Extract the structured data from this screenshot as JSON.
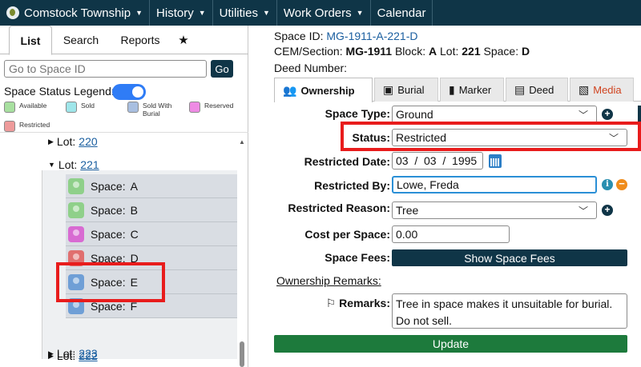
{
  "nav": {
    "items": [
      {
        "label": "Comstock Township",
        "has_caret": true
      },
      {
        "label": "History",
        "has_caret": true
      },
      {
        "label": "Utilities",
        "has_caret": true
      },
      {
        "label": "Work Orders",
        "has_caret": true
      },
      {
        "label": "Calendar",
        "has_caret": false
      }
    ]
  },
  "left": {
    "tabs": [
      "List",
      "Search",
      "Reports",
      "★"
    ],
    "search_placeholder": "Go to Space ID",
    "go_label": "Go",
    "legend_title": "Space Status Legend:",
    "legend": [
      {
        "label": "Available",
        "color": "#a8e0a0"
      },
      {
        "label": "Sold",
        "color": "#9fe6ea"
      },
      {
        "label": "Sold With Burial",
        "color": "#a9bfe0"
      },
      {
        "label": "Reserved",
        "color": "#ee8be4"
      },
      {
        "label": "Restricted",
        "color": "#ee9b9b"
      }
    ],
    "lot_prefix": "Lot:",
    "lots": {
      "lot220": "220",
      "lot221": "221",
      "lot222": "222",
      "lot223": "223"
    },
    "space_prefix": "Space:",
    "spaces": [
      {
        "letter": "A",
        "color": "#8fd08a"
      },
      {
        "letter": "B",
        "color": "#8fd08a"
      },
      {
        "letter": "C",
        "color": "#d86bd2"
      },
      {
        "letter": "D",
        "color": "#e06f6f"
      },
      {
        "letter": "E",
        "color": "#6f9fd6"
      },
      {
        "letter": "F",
        "color": "#6f9fd6"
      }
    ]
  },
  "right": {
    "space_id_label": "Space ID:",
    "space_id_value": "MG-1911-A-221-D",
    "cem_section_label": "CEM/Section:",
    "cem_section_value": "MG-1911",
    "block_label": "Block:",
    "block_value": "A",
    "lot_label": "Lot:",
    "lot_value": "221",
    "space_label": "Space:",
    "space_value": "D",
    "deed_number_label": "Deed Number:",
    "tabs": [
      "Ownership",
      "Burial",
      "Marker",
      "Deed",
      "Media"
    ],
    "fields": {
      "space_type_label": "Space Type:",
      "space_type_value": "Ground",
      "status_label": "Status:",
      "status_value": "Restricted",
      "restricted_date_label": "Restricted Date:",
      "restricted_date_value": "03  /  03  /  1995",
      "restricted_by_label": "Restricted By:",
      "restricted_by_value": "Lowe, Freda",
      "restricted_reason_label": "Restricted Reason:",
      "restricted_reason_value": "Tree",
      "cost_label": "Cost per Space:",
      "cost_value": "0.00",
      "fees_label": "Space Fees:",
      "fees_button": "Show Space Fees",
      "ownership_remarks": "Ownership Remarks:",
      "remarks_label": "Remarks:",
      "remarks_line1": "Tree in space makes it unsuitable for burial.",
      "remarks_line2": "Do not sell."
    },
    "update_label": "Update"
  },
  "colors": {
    "nav_bg": "#0f3547",
    "highlight": "#e81c1c",
    "update_green": "#1d7a3c",
    "link_blue": "#1b5fa0"
  }
}
